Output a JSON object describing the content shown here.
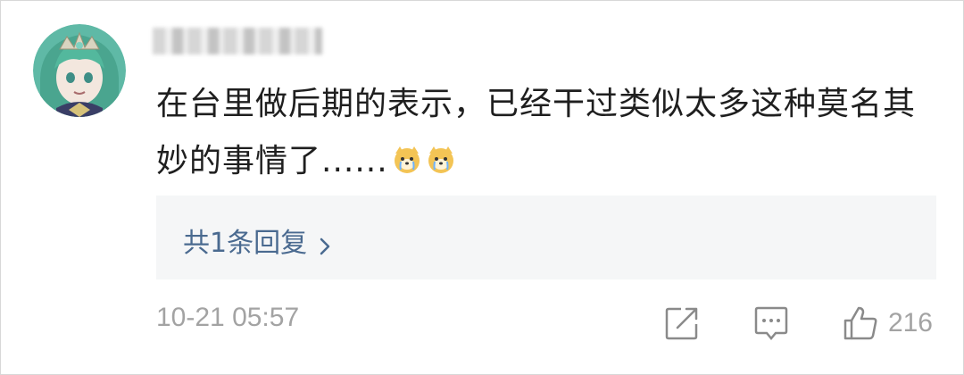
{
  "comment": {
    "text": "在台里做后期的表示，已经干过类似太多这种莫名其妙的事情了......",
    "emoji_icon": "crying-dog-emoji-icon",
    "emoji_count": 2
  },
  "reply": {
    "label": "共1条回复"
  },
  "footer": {
    "timestamp": "10-21 05:57",
    "like_count": "216"
  },
  "colors": {
    "link": "#4a6a90",
    "meta": "#a3a3a3",
    "reply_bg": "#f5f6f7"
  }
}
